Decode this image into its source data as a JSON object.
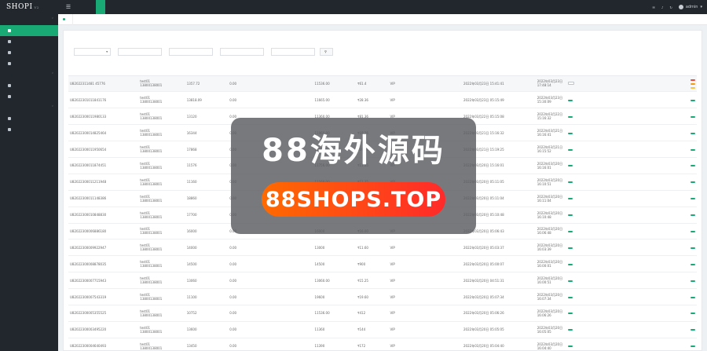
{
  "app": {
    "logo": "SHOPI",
    "version": "V2",
    "menu_icon": "hamburger-icon"
  },
  "topnav": [
    {
      "label": "",
      "active": false
    },
    {
      "label": "",
      "active": false
    },
    {
      "label": "",
      "active": true
    },
    {
      "label": "",
      "active": false
    },
    {
      "label": "",
      "active": false
    },
    {
      "label": "",
      "active": false
    }
  ],
  "topbar": {
    "stat_line1": "",
    "stat_line2": "",
    "icon1_label": "",
    "icon1_badge": "",
    "icon2_label": "",
    "icon2_badge": "",
    "refresh_icon": "refresh-icon",
    "user": "admin"
  },
  "sidebar": {
    "groups": [
      {
        "title": "",
        "items": [
          {
            "label": "",
            "active": true
          },
          {
            "label": "",
            "active": false
          },
          {
            "label": "",
            "active": false
          },
          {
            "label": "",
            "active": false
          }
        ]
      },
      {
        "title": "",
        "items": [
          {
            "label": "",
            "active": false
          },
          {
            "label": "",
            "active": false
          }
        ]
      },
      {
        "title": "",
        "items": [
          {
            "label": "",
            "active": false
          },
          {
            "label": "",
            "active": false
          }
        ]
      }
    ]
  },
  "tabs": [
    {
      "label": ""
    }
  ],
  "search": {
    "title": "",
    "status_label": "",
    "status_value": "",
    "order_label": "",
    "order_placeholder": "",
    "user_label": "",
    "user_placeholder": "",
    "order2_label": "",
    "order2_placeholder": "",
    "time_label": "",
    "time_placeholder": "",
    "button": ""
  },
  "table": {
    "headers": [
      "",
      "",
      "",
      "",
      "",
      "",
      "",
      "",
      "",
      "",
      "",
      "",
      ""
    ],
    "rows": [
      {
        "id": "U82022311481 45776",
        "user": "test01",
        "phone": "13800138001",
        "v1": "1357.72",
        "v2": "0.00",
        "v3": "",
        "v4": "11536.00",
        "v5": "₹61.4",
        "v6": "VIP",
        "t1": "2022年03月23日 15:41:41",
        "t2": "2022年03月23日 17:48:14",
        "s1": "",
        "s2": "",
        "btns": [
          {
            "label": "",
            "kind": "red"
          },
          {
            "label": "",
            "kind": "orange"
          },
          {
            "label": "",
            "kind": "yellow"
          }
        ],
        "status_btn_outline": true
      },
      {
        "id": "U82022301011841176",
        "user": "test01",
        "phone": "13800138001",
        "v1": "13818.09",
        "v2": "0.00",
        "v3": "",
        "v4": "11665.00",
        "v5": "₹28.36",
        "v6": "VIP",
        "t1": "2022年03月23日 05:15:49",
        "t2": "2022年03月23日 15:30:09",
        "s1": "",
        "s2": "",
        "btns": [
          {
            "label": "",
            "kind": "green"
          }
        ]
      },
      {
        "id": "U82022300011980133",
        "user": "test01",
        "phone": "13800138001",
        "v1": "13120",
        "v2": "0.00",
        "v3": "",
        "v4": "11360.00",
        "v5": "₹81.36",
        "v6": "VIP",
        "t1": "2022年03月22日 05:15:08",
        "t2": "2022年03月22日 15:16:32",
        "s1": "",
        "s2": "",
        "btns": [
          {
            "label": "",
            "kind": "green"
          }
        ]
      },
      {
        "id": "U82022300014825464",
        "user": "test01",
        "phone": "13800138001",
        "v1": "16344",
        "v2": "0.00",
        "v3": "",
        "v4": "11960.00",
        "v5": "₹19.26",
        "v6": "VIP",
        "t1": "2022年03月21日 15:16:32",
        "t2": "2022年03月21日 16:16:41",
        "s1": "",
        "s2": "",
        "btns": [
          {
            "label": "",
            "kind": "green"
          }
        ]
      },
      {
        "id": "U82022300011950654",
        "user": "test01",
        "phone": "13800138001",
        "v1": "17868",
        "v2": "0.00",
        "v3": "",
        "v4": "11860.00",
        "v5": "₹19.21",
        "v6": "VIP",
        "t1": "2022年03月21日 15:19:25",
        "t2": "2022年03月21日 16:15:52",
        "s1": "",
        "s2": "",
        "btns": [
          {
            "label": "",
            "kind": "green"
          }
        ]
      },
      {
        "id": "U82022300011874451",
        "user": "test01",
        "phone": "13800138001",
        "v1": "11576",
        "v2": "0.00",
        "v3": "",
        "v4": "11756.00",
        "v5": "₹11.35",
        "v6": "VIP",
        "t1": "2022年03月20日 15:16:01",
        "t2": "2022年03月20日 16:16:01",
        "s1": "",
        "s2": "",
        "btns": [
          {
            "label": "",
            "kind": "green"
          }
        ]
      },
      {
        "id": "U82022300011211948",
        "user": "test01",
        "phone": "13800138001",
        "v1": "11160",
        "v2": "0.00",
        "v3": "",
        "v4": "11160.00",
        "v5": "₹11.35",
        "v6": "VIP",
        "t1": "2022年03月20日 05:11:05",
        "t2": "2022年03月20日 16:10:51",
        "s1": "",
        "s2": "",
        "btns": [
          {
            "label": "",
            "kind": "green"
          }
        ]
      },
      {
        "id": "U82022300011148386",
        "user": "test01",
        "phone": "13800138001",
        "v1": "18860",
        "v2": "0.00",
        "v3": "",
        "v4": "11868.00",
        "v5": "₹18.86",
        "v6": "VIP",
        "t1": "2022年03月20日 05:11:04",
        "t2": "2022年03月20日 16:11:04",
        "s1": "",
        "s2": "",
        "btns": [
          {
            "label": "",
            "kind": "green"
          }
        ]
      },
      {
        "id": "U82022300010848830",
        "user": "test01",
        "phone": "13800138001",
        "v1": "17700",
        "v2": "0.00",
        "v3": "",
        "v4": "17700.00",
        "v5": "₹17.70",
        "v6": "VIP",
        "t1": "2022年03月20日 05:10:48",
        "t2": "2022年03月20日 16:10:48",
        "s1": "",
        "s2": "",
        "btns": [
          {
            "label": "",
            "kind": "green"
          }
        ]
      },
      {
        "id": "U82022300006886180",
        "user": "test01",
        "phone": "13800138001",
        "v1": "16000",
        "v2": "0.00",
        "v3": "",
        "v4": "16000",
        "v5": "₹16.00",
        "v6": "VIP",
        "t1": "2022年03月20日 05:06:43",
        "t2": "2022年03月20日 16:06:48",
        "s1": "",
        "s2": "",
        "btns": [
          {
            "label": "",
            "kind": "green"
          }
        ]
      },
      {
        "id": "U82022300009922947",
        "user": "test01",
        "phone": "13800138001",
        "v1": "14000",
        "v2": "0.00",
        "v3": "",
        "v4": "13000",
        "v5": "₹11.60",
        "v6": "VIP",
        "t1": "2022年03月20日 05:03:37",
        "t2": "2022年03月20日 16:03:39",
        "s1": "",
        "s2": "",
        "btns": [
          {
            "label": "",
            "kind": "green"
          }
        ]
      },
      {
        "id": "U82022300008878035",
        "user": "test01",
        "phone": "13800138001",
        "v1": "14500",
        "v2": "0.00",
        "v3": "",
        "v4": "14500",
        "v5": "₹900",
        "v6": "VIP",
        "t1": "2022年03月20日 05:00:07",
        "t2": "2022年03月20日 16:00:01",
        "s1": "",
        "s2": "",
        "btns": [
          {
            "label": "",
            "kind": "green"
          }
        ]
      },
      {
        "id": "U82022300007715943",
        "user": "test01",
        "phone": "13800138001",
        "v1": "13060",
        "v2": "0.00",
        "v3": "",
        "v4": "13060.00",
        "v5": "₹15.25",
        "v6": "VIP",
        "t1": "2022年03月20日 04:51:31",
        "t2": "2022年03月20日 16:00:51",
        "s1": "",
        "s2": "",
        "btns": [
          {
            "label": "",
            "kind": "green"
          }
        ]
      },
      {
        "id": "U82022300007543319",
        "user": "test01",
        "phone": "13800138001",
        "v1": "11100",
        "v2": "0.00",
        "v3": "",
        "v4": "19600",
        "v5": "₹19.60",
        "v6": "VIP",
        "t1": "2022年03月20日 05:07:34",
        "t2": "2022年03月20日 16:07:34",
        "s1": "",
        "s2": "",
        "btns": [
          {
            "label": "",
            "kind": "green"
          }
        ]
      },
      {
        "id": "U82022300005355525",
        "user": "test01",
        "phone": "13800138001",
        "v1": "10752",
        "v2": "0.00",
        "v3": "",
        "v4": "11536.00",
        "v5": "₹412",
        "v6": "VIP",
        "t1": "2022年03月20日 05:06:26",
        "t2": "2022年03月20日 16:06:26",
        "s1": "",
        "s2": "",
        "btns": [
          {
            "label": "",
            "kind": "green"
          }
        ]
      },
      {
        "id": "U82022300003495220",
        "user": "test01",
        "phone": "13800138001",
        "v1": "13600",
        "v2": "0.00",
        "v3": "",
        "v4": "11360",
        "v5": "₹144",
        "v6": "VIP",
        "t1": "2022年03月20日 05:05:05",
        "t2": "2022年03月20日 16:05:05",
        "s1": "",
        "s2": "",
        "btns": [
          {
            "label": "",
            "kind": "green"
          }
        ]
      },
      {
        "id": "U82022300004640493",
        "user": "test01",
        "phone": "13800138001",
        "v1": "13450",
        "v2": "0.00",
        "v3": "",
        "v4": "11390",
        "v5": "₹172",
        "v6": "VIP",
        "t1": "2022年03月20日 05:04:40",
        "t2": "2022年03月20日 16:04:40",
        "s1": "",
        "s2": "",
        "btns": [
          {
            "label": "",
            "kind": "green"
          }
        ]
      }
    ]
  },
  "watermark": {
    "title": "88海外源码",
    "url": "88SHOPS.TOP"
  }
}
